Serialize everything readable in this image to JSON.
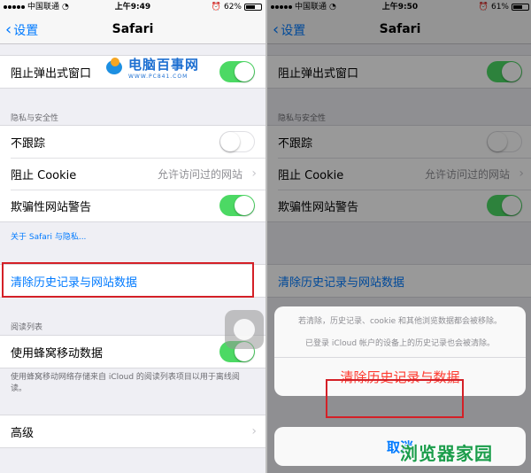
{
  "left": {
    "status": {
      "carrier": "中国联通",
      "time": "上午9:49",
      "battery": "62%",
      "battery_level": 0.62
    },
    "nav": {
      "back_label": "设置",
      "title": "Safari"
    },
    "popup_row": {
      "label": "阻止弹出式窗口",
      "on": true
    },
    "privacy_header": "隐私与安全性",
    "privacy_rows": [
      {
        "label": "不跟踪",
        "on": false
      },
      {
        "label": "阻止 Cookie",
        "value": "允许访问过的网站"
      },
      {
        "label": "欺骗性网站警告",
        "on": true
      }
    ],
    "privacy_footer_link": "关于 Safari 与隐私...",
    "clear_label": "清除历史记录与网站数据",
    "reading_header": "阅读列表",
    "cellular_row": {
      "label": "使用蜂窝移动数据",
      "on": true
    },
    "reading_footer": "使用蜂窝移动网络存储来自 iCloud 的阅读列表项目以用于离线阅读。",
    "advanced_label": "高级"
  },
  "right": {
    "status": {
      "carrier": "中国联通",
      "time": "上午9:50",
      "battery": "61%",
      "battery_level": 0.61
    },
    "nav": {
      "back_label": "设置",
      "title": "Safari"
    },
    "popup_row": {
      "label": "阻止弹出式窗口",
      "on": true
    },
    "privacy_header": "隐私与安全性",
    "privacy_rows": [
      {
        "label": "不跟踪",
        "on": false
      },
      {
        "label": "阻止 Cookie",
        "value": "允许访问过的网站"
      },
      {
        "label": "欺骗性网站警告",
        "on": true
      }
    ],
    "clear_label": "清除历史记录与网站数据",
    "sheet": {
      "message": "若清除，历史记录、cookie 和其他浏览数据都会被移除。",
      "message2": "已登录 iCloud 帐户的设备上的历史记录也会被清除。",
      "action": "清除历史记录与数据",
      "cancel": "取消"
    }
  },
  "watermarks": {
    "left_title": "电脑百事网",
    "left_url": "WWW.PC841.COM",
    "right": "浏览器家园"
  },
  "colors": {
    "accent": "#007aff",
    "switch_on": "#4cd964",
    "highlight": "#d42027",
    "destructive": "#ff3b30"
  }
}
